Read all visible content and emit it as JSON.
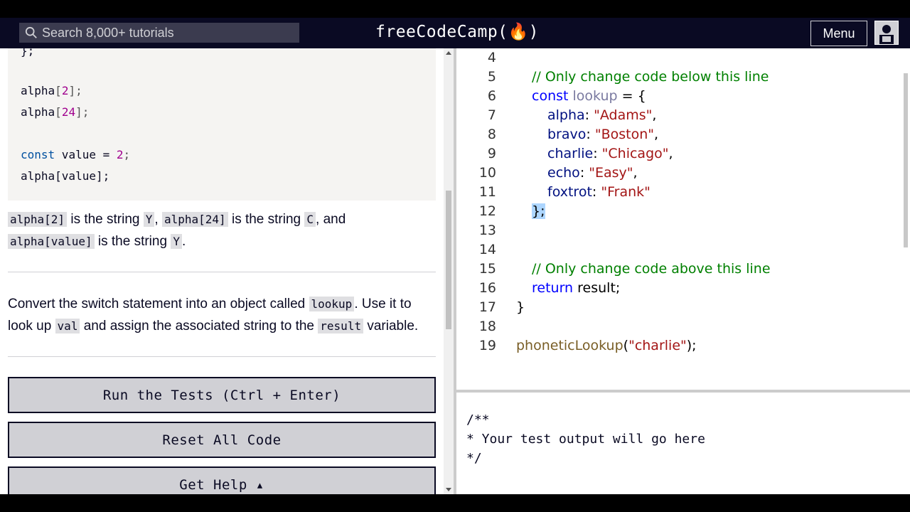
{
  "header": {
    "search_placeholder": "Search 8,000+ tutorials",
    "brand": "freeCodeCamp(🔥)",
    "menu_label": "Menu"
  },
  "lesson": {
    "code_example": {
      "line_partial": "};",
      "line1_obj": "alpha",
      "line1_idx": "2",
      "line2_obj": "alpha",
      "line2_idx": "24",
      "line3_kw": "const",
      "line3_name": " value = ",
      "line3_num": "2",
      "line4": "alpha[value];"
    },
    "explanation": {
      "code1": "alpha[2]",
      "text1": " is the string ",
      "code2": "Y",
      "text2": ", ",
      "code3": "alpha[24]",
      "text3": " is the string ",
      "code4": "C",
      "text4": ", and",
      "code5": "alpha[value]",
      "text5": " is the string ",
      "code6": "Y",
      "text6": "."
    },
    "instructions": {
      "text1": "Convert the switch statement into an object called ",
      "code1": "lookup",
      "text2": ". Use it to look up ",
      "code2": "val",
      "text3": " and assign the associated string to the ",
      "code3": "result",
      "text4": " variable."
    },
    "buttons": {
      "run": "Run the Tests (Ctrl + Enter)",
      "reset": "Reset All Code",
      "help": "Get Help ▴"
    }
  },
  "editor": {
    "lines": [
      {
        "n": "4"
      },
      {
        "n": "5",
        "comment": "// Only change code below this line"
      },
      {
        "n": "6",
        "kw": "const",
        "var": "lookup",
        "rest": " = {"
      },
      {
        "n": "7",
        "prop": "alpha",
        "str": "\"Adams\"",
        "end": ","
      },
      {
        "n": "8",
        "prop": "bravo",
        "str": "\"Boston\"",
        "end": ","
      },
      {
        "n": "9",
        "prop": "charlie",
        "str": "\"Chicago\"",
        "end": ","
      },
      {
        "n": "10",
        "prop": "echo",
        "str": "\"Easy\"",
        "end": ","
      },
      {
        "n": "11",
        "prop": "foxtrot",
        "str": "\"Frank\"",
        "end": ""
      },
      {
        "n": "12",
        "closing": "};"
      },
      {
        "n": "13"
      },
      {
        "n": "14"
      },
      {
        "n": "15",
        "comment": "// Only change code above this line"
      },
      {
        "n": "16",
        "kw": "return",
        "rest": " result;"
      },
      {
        "n": "17",
        "brace": "}"
      },
      {
        "n": "18"
      },
      {
        "n": "19",
        "fn": "phoneticLookup",
        "arg": "\"charlie\"",
        "tail": ");"
      }
    ]
  },
  "output": {
    "line1": "/**",
    "line2": "* Your test output will go here",
    "line3": "*/"
  },
  "colors": {
    "nav_bg": "#0a0a23",
    "button_bg": "#d0d0d5",
    "comment": "#008000",
    "string": "#a31515",
    "keyword": "#0000ff"
  }
}
